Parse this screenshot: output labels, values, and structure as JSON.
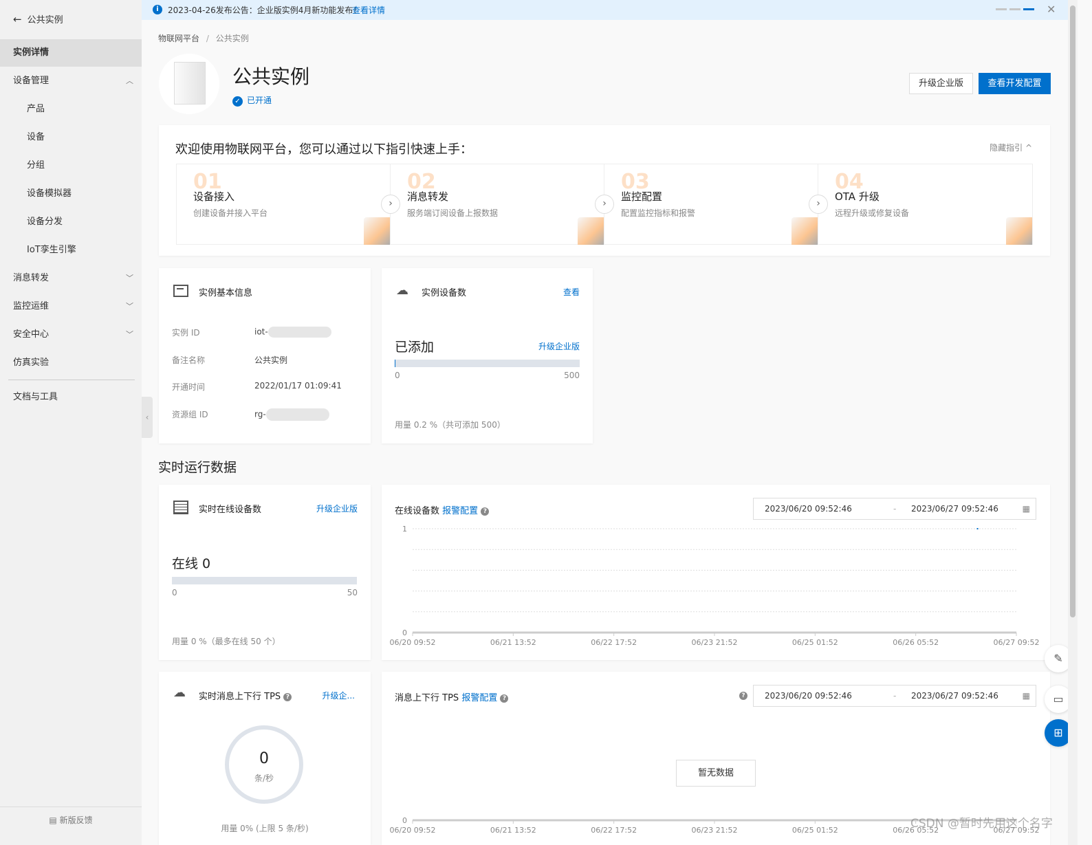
{
  "banner": {
    "text": "2023-04-26发布公告：企业版实例4月新功能发布！",
    "link": "查看详情"
  },
  "sidebar": {
    "back_label": "公共实例",
    "items": [
      {
        "label": "实例详情"
      },
      {
        "label": "设备管理"
      },
      {
        "label": "产品"
      },
      {
        "label": "设备"
      },
      {
        "label": "分组"
      },
      {
        "label": "设备模拟器"
      },
      {
        "label": "设备分发"
      },
      {
        "label": "IoT孪生引擎"
      },
      {
        "label": "消息转发"
      },
      {
        "label": "监控运维"
      },
      {
        "label": "安全中心"
      },
      {
        "label": "仿真实验"
      },
      {
        "label": "文档与工具"
      }
    ],
    "feedback": "新版反馈"
  },
  "breadcrumb": [
    "物联网平台",
    "/",
    "公共实例"
  ],
  "header": {
    "title": "公共实例",
    "status": "已开通",
    "upgrade_btn": "升级企业版",
    "dev_config_btn": "查看开发配置"
  },
  "guide": {
    "title": "欢迎使用物联网平台，您可以通过以下指引快速上手：",
    "hide": "隐藏指引",
    "steps": [
      {
        "num": "01",
        "title": "设备接入",
        "desc": "创建设备并接入平台"
      },
      {
        "num": "02",
        "title": "消息转发",
        "desc": "服务端订阅设备上报数据"
      },
      {
        "num": "03",
        "title": "监控配置",
        "desc": "配置监控指标和报警"
      },
      {
        "num": "04",
        "title": "OTA 升级",
        "desc": "远程升级或修复设备"
      }
    ]
  },
  "basic_info": {
    "title": "实例基本信息",
    "rows": [
      {
        "label": "实例 ID",
        "value": "iot-"
      },
      {
        "label": "备注名称",
        "value": "公共实例"
      },
      {
        "label": "开通时间",
        "value": "2022/01/17 01:09:41"
      },
      {
        "label": "资源组 ID",
        "value": "rg-"
      }
    ]
  },
  "device_count": {
    "title": "实例设备数",
    "view": "查看",
    "added": "已添加",
    "upgrade": "升级企业版",
    "min": "0",
    "max": "500",
    "usage_percent": 0.2,
    "usage_text": "用量 0.2 %（共可添加 500）"
  },
  "section_title": "实时运行数据",
  "online": {
    "title": "实时在线设备数",
    "upgrade": "升级企业版",
    "value": "在线 0",
    "min": "0",
    "max": "50",
    "usage_percent": 0,
    "usage_text": "用量 0 %（最多在线 50 个）"
  },
  "tps": {
    "title": "实时消息上下行 TPS",
    "upgrade": "升级企...",
    "value": "0",
    "unit": "条/秒",
    "usage_text": "用量 0% (上限 5 条/秒)"
  },
  "online_chart": {
    "title": "在线设备数",
    "alarm": "报警配置",
    "start": "2023/06/20 09:52:46",
    "sep": "-",
    "end": "2023/06/27 09:52:46"
  },
  "tps_chart": {
    "title": "消息上下行 TPS",
    "alarm": "报警配置",
    "start": "2023/06/20 09:52:46",
    "sep": "-",
    "end": "2023/06/27 09:52:46",
    "empty": "暂无数据"
  },
  "chart_data": [
    {
      "type": "line",
      "title": "在线设备数",
      "x_ticks": [
        "06/20 09:52",
        "06/21 13:52",
        "06/22 17:52",
        "06/23 21:52",
        "06/25 01:52",
        "06/26 05:52",
        "06/27 09:52"
      ],
      "y_ticks": [
        "0",
        "1"
      ],
      "ylim": [
        0,
        1
      ],
      "grid": true,
      "series": [
        {
          "name": "在线设备数",
          "points": [
            {
              "x": "06/26 23:00",
              "y": 1
            }
          ]
        }
      ]
    },
    {
      "type": "line",
      "title": "消息上下行 TPS",
      "x_ticks": [
        "06/20 09:52",
        "06/21 13:52",
        "06/22 17:52",
        "06/23 21:52",
        "06/25 01:52",
        "06/26 05:52",
        "06/27 09:52"
      ],
      "y_ticks": [
        "0"
      ],
      "series": []
    }
  ],
  "watermark": "CSDN @暂时先用这个名字",
  "colors": {
    "primary": "#0070cc",
    "banner_bg": "#e3f1fd",
    "accent_orange": "#fbb676"
  }
}
